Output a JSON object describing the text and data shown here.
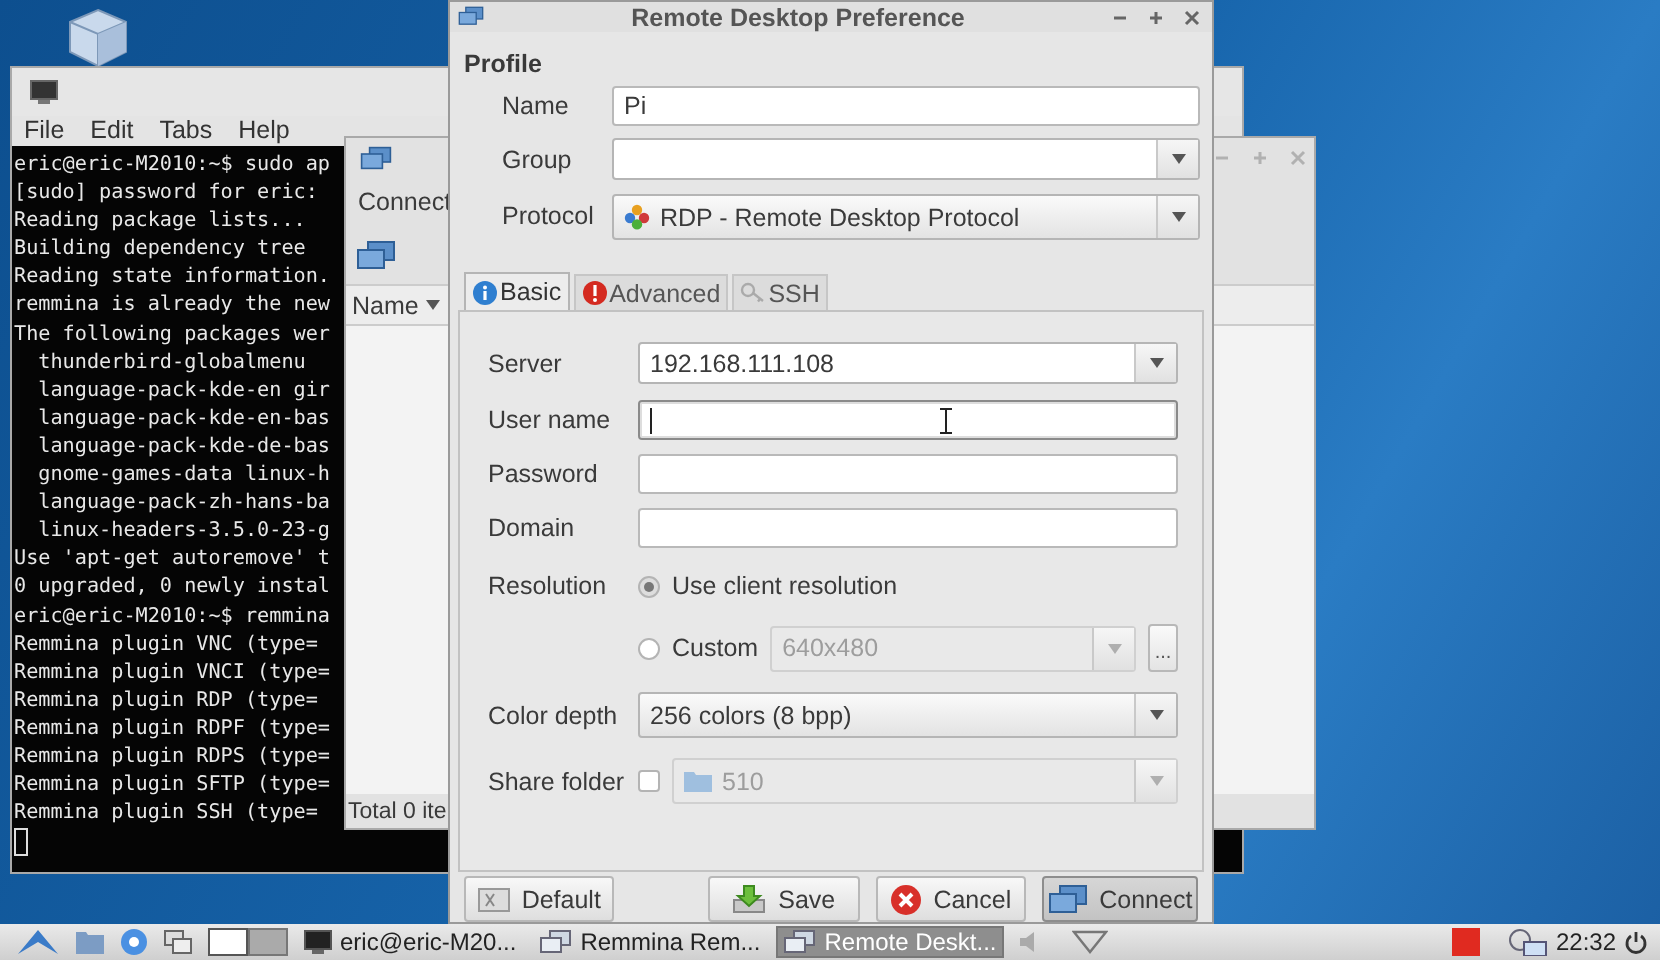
{
  "terminal": {
    "menu": [
      "File",
      "Edit",
      "Tabs",
      "Help"
    ],
    "lines": [
      "eric@eric-M2010:~$ sudo ap",
      "[sudo] password for eric:",
      "Reading package lists...",
      "Building dependency tree",
      "Reading state information.",
      "remmina is already the new",
      "The following packages wer",
      "  thunderbird-globalmenu",
      "  language-pack-kde-en gir",
      "  language-pack-kde-en-bas",
      "  language-pack-kde-de-bas",
      "  gnome-games-data linux-h",
      "  language-pack-zh-hans-ba",
      "  linux-headers-3.5.0-23-g",
      "Use 'apt-get autoremove' t",
      "0 upgraded, 0 newly instal",
      "eric@eric-M2010:~$ remmina",
      "Remmina plugin VNC (type=",
      "Remmina plugin VNCI (type=",
      "Remmina plugin RDP (type=",
      "Remmina plugin RDPF (type=",
      "Remmina plugin RDPS (type=",
      "Remmina plugin SFTP (type=",
      "Remmina plugin SSH (type="
    ]
  },
  "remmina_window": {
    "menu": "Connect",
    "column": "Name",
    "status": "Total 0 ite"
  },
  "dialog": {
    "title": "Remote Desktop Preference",
    "section": "Profile",
    "profile": [
      {
        "label": "Name",
        "kind": "text",
        "value": "Pi"
      },
      {
        "label": "Group",
        "kind": "combo"
      },
      {
        "label": "Protocol",
        "kind": "protocol",
        "value": "RDP - Remote Desktop Protocol"
      }
    ],
    "tabs": [
      {
        "label": "Basic",
        "kind": "info",
        "selected": true
      },
      {
        "label": "Advanced",
        "kind": "warning",
        "selected": false
      },
      {
        "label": "SSH",
        "kind": "key",
        "selected": false
      }
    ],
    "server": {
      "label": "Server",
      "value": "192.168.111.108"
    },
    "text_fields": [
      {
        "label": "User name",
        "focused": true
      },
      {
        "label": "Password",
        "focused": false
      },
      {
        "label": "Domain",
        "focused": false
      }
    ],
    "resolution": {
      "label": "Resolution",
      "options": [
        {
          "label": "Use client resolution",
          "selected": true
        },
        {
          "label": "Custom",
          "selected": false,
          "value": "640x480"
        }
      ],
      "more_button": "..."
    },
    "color_depth": {
      "label": "Color depth",
      "value": "256 colors (8 bpp)"
    },
    "share_folder": {
      "label": "Share folder",
      "checked": false,
      "value": "510"
    },
    "buttons": [
      {
        "label": "Default",
        "kind": "default",
        "focused": false
      },
      {
        "label": "Save",
        "kind": "save",
        "focused": false
      },
      {
        "label": "Cancel",
        "kind": "cancel",
        "focused": false
      },
      {
        "label": "Connect",
        "kind": "connect",
        "focused": true
      }
    ]
  },
  "taskbar": {
    "tasks": [
      {
        "label": "eric@eric-M20...",
        "kind": "terminal",
        "selected": false
      },
      {
        "label": "Remmina Rem...",
        "kind": "remmina",
        "selected": false
      },
      {
        "label": "Remote Deskt...",
        "kind": "remmina",
        "selected": true
      }
    ],
    "clock": "22:32"
  }
}
